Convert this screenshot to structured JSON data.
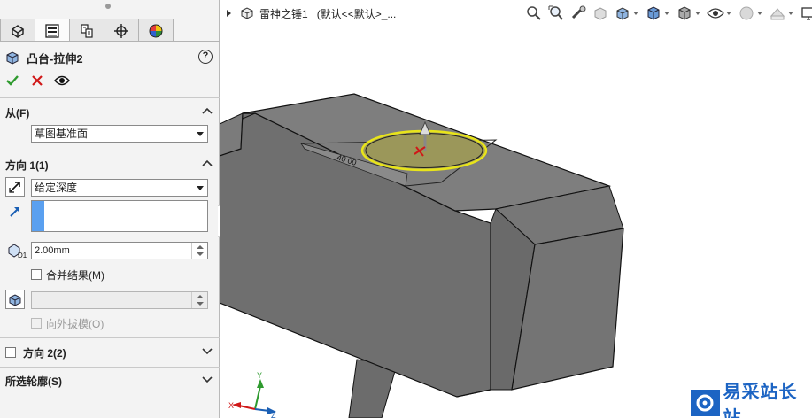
{
  "property_manager": {
    "tabs": [
      "feature-manager",
      "property-manager",
      "configuration-manager",
      "dimxpert-manager",
      "display-manager"
    ],
    "feature_title": "凸台-拉伸2",
    "help": "?",
    "from_section": {
      "label": "从(F)",
      "start_condition": "草图基准面"
    },
    "direction1": {
      "label": "方向 1(1)",
      "end_condition": "给定深度",
      "depth": "2.00mm",
      "merge_result": "合并结果(M)",
      "draft_outward": "向外拔模(O)"
    },
    "direction2": {
      "label": "方向 2(2)"
    },
    "selected_contours": {
      "label": "所选轮廓(S)"
    }
  },
  "toolbar": {
    "document_name": "雷神之锤1",
    "configuration": "(默认<<默认>_..."
  },
  "model": {
    "sketch_text": "40 00"
  },
  "triad": {
    "x": "X",
    "y": "Y",
    "z": "Z"
  },
  "watermark": {
    "text": "易采站长站"
  },
  "colors": {
    "accept": "#2e9a2e",
    "cancel": "#d01818",
    "accent": "#1c64c3",
    "sketch_profile": "#e8e41a"
  }
}
